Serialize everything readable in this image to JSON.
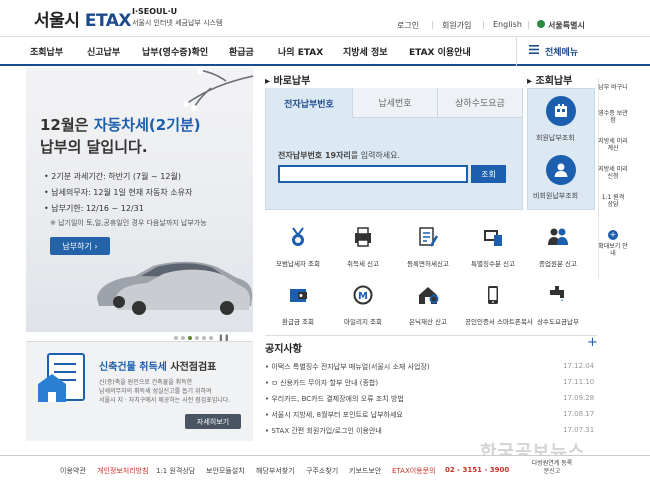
{
  "header": {
    "logo_main": "서울시",
    "logo_etax": "ETAX",
    "logo_sub1": "I·SEOUL·U",
    "logo_sub2": "서울시 인터넷 세금납부 시스템",
    "util": [
      "로그인",
      "회원가입",
      "English",
      "서울특별시"
    ]
  },
  "nav": {
    "items": [
      "조회납부",
      "신고납부",
      "납부(영수증)확인",
      "환급금",
      "나의 ETAX",
      "지방세 정보",
      "ETAX 이용안내"
    ],
    "all_menu": "전체메뉴"
  },
  "banner": {
    "title_prefix": "12월은 ",
    "title_highlight": "자동차세(2기분)",
    "title2": "납부의 달입니다.",
    "bullets": [
      "2기분 과세기간: 하반기 (7월 ~ 12월)",
      "납세의무자: 12월 1일 현재 자동차 소유자",
      "납부기한: 12/16 ~ 12/31"
    ],
    "note": "※ 납기일이 토,일,공휴일인 경우 다음날까지 납부가능",
    "button": "납부하기 ›"
  },
  "promo": {
    "title_highlight": "신축건물 취득세",
    "title_rest": " 사전점검표",
    "text": [
      "신(증)축을 원인으로 건축물을 취득한",
      "납세의무자의 취득세 성실신고를 돕기 위하여",
      "서울시 지 · 자치구에서 제공하는 사전 점검표입니다."
    ],
    "button": "자세히보기"
  },
  "payment": {
    "section_title": "바로납부",
    "tabs": [
      "전자납부번호",
      "납세번호",
      "상하수도요금"
    ],
    "label_bold": "전자납부번호 19자리",
    "label_rest": "를 입력하세요.",
    "input_value": "",
    "submit": "조회"
  },
  "lookup": {
    "section_title": "조회납부",
    "items": [
      "회원납부조회",
      "비회원납부조회"
    ]
  },
  "services": [
    "모범납세자 조회",
    "취득세 신고",
    "등록면허세신고",
    "특별징수분 신고",
    "종업원분 신고",
    "환급금 조회",
    "마일리지 조회",
    "은닉재산 신고",
    "공인인증서 스마트폰복사",
    "상수도요금납부"
  ],
  "notice": {
    "section_title": "공지사항",
    "more": "+",
    "items": [
      {
        "title": "이택스 특별징수 전자납부 매뉴얼(서울시 소재 사업장)",
        "date": "17.12.04"
      },
      {
        "title": "ㅁ 신용카드 무이자 할부 안내 (종합)",
        "date": "17.11.10"
      },
      {
        "title": "우리카드, BC카드 결제장애의 오류 조치 방법",
        "date": "17.09.28"
      },
      {
        "title": "서울시 지방세, 8월부터 포인트로 납부하세요",
        "date": "17.08.17"
      },
      {
        "title": "STAX 간편 회원가입/로그인 이용안내",
        "date": "17.07.31"
      }
    ]
  },
  "side": {
    "items": [
      "납부 바구니",
      "영수증 보관함",
      "지방세 미리계산",
      "지방세 미리신청",
      "1:1 원격 상담",
      "확대보기 안내"
    ]
  },
  "footer": {
    "links": [
      "이용약관",
      "개인정보처리방침",
      "1:1 원격상담",
      "보안모듈설치",
      "해당부서찾기",
      "구주소찾기",
      "키보드보안"
    ],
    "service": "ETAX이용문의",
    "phone": "02 - 3151 - 3900",
    "right": "다방원연계 동록분신고"
  },
  "watermark": "한국공보뉴스"
}
